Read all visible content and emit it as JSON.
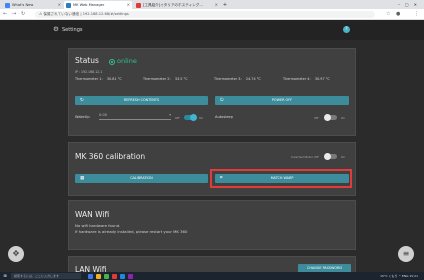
{
  "browser": {
    "tabs": [
      {
        "title": "What's New"
      },
      {
        "title": "MK Web Manager"
      },
      {
        "title": "[工具紹介]イタリアのホスティング..."
      }
    ],
    "address": {
      "security": "保護されていない通信",
      "url": "192.168.12.68/#/settings"
    }
  },
  "header": {
    "title": "Settings"
  },
  "status_card": {
    "heading": "Status",
    "state": "online",
    "ip": "IP : 192.168.12.1",
    "thermometers": [
      {
        "label": "Thermometer 1:",
        "value": "30.81 °C"
      },
      {
        "label": "Thermometer 2:",
        "value": "33.5 °C"
      },
      {
        "label": "Thermometer 3:",
        "value": "24.74 °C"
      },
      {
        "label": "Thermometer 4:",
        "value": "30.97 °C"
      }
    ],
    "refresh_label": "REFRESH CONTENTS",
    "power_label": "POWER OFF",
    "wakeup_label": "WakeUp",
    "wakeup_value": "0:00",
    "wakeup_toggle_off": "Off",
    "wakeup_toggle_on": "On",
    "autosleep_label": "Autosleep",
    "autosleep_off": "Off",
    "autosleep_on": "On"
  },
  "calib_card": {
    "heading": "MK 360 calibration",
    "inverted_label": "Inverted Motor Off",
    "inverted_on": "On",
    "calibration_label": "CALIBRATION",
    "match_label": "MATCH WARP"
  },
  "wan_card": {
    "heading": "WAN Wifi",
    "line1": "No wifi hardware found.",
    "line2": "If hardware is already installed, please restart your MK 360"
  },
  "lan_card": {
    "heading": "LAN Wifi",
    "change_password": "CHANGE PASSWORD"
  },
  "taskbar": {
    "search": "検索するには、ここに入力します",
    "clock": "15°C  くもり ^  ENG  15:21"
  }
}
